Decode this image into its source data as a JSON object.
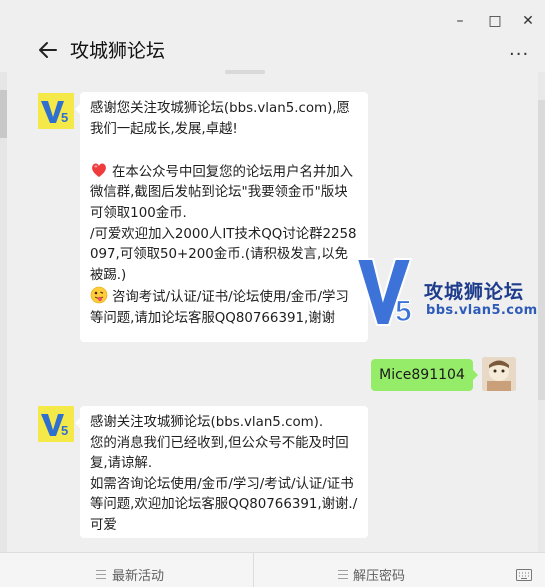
{
  "header": {
    "title": "攻城狮论坛"
  },
  "messages": [
    {
      "sender": "official",
      "lines": [
        "感谢您关注攻城狮论坛(bbs.vlan5.com),愿我们一起成长,发展,卓越!",
        "",
        "在本公众号中回复您的论坛用户名并加入微信群,截图后发帖到论坛\"我要领金币\"版块可领取100金币.",
        "/可爱欢迎加入2000人IT技术QQ讨论群2258097,可领取50+200金币.(请积极发言,以免被踢.)",
        "咨询考试/认证/证书/论坛使用/金币/学习等问题,请加论坛客服QQ80766391,谢谢"
      ],
      "emoji_1": "heart-icon",
      "emoji_2": "tongue-face-icon"
    },
    {
      "sender": "user",
      "text": "Mice891104"
    },
    {
      "sender": "official",
      "lines": [
        "感谢关注攻城狮论坛(bbs.vlan5.com).",
        "您的消息我们已经收到,但公众号不能及时回复,请谅解.",
        "如需咨询论坛使用/金币/学习/考试/认证/证书等问题,欢迎加论坛客服QQ80766391,谢谢./可爱"
      ]
    }
  ],
  "watermark": {
    "title": "攻城狮论坛",
    "url": "bbs.vlan5.com"
  },
  "footer": {
    "menu_1": "最新活动",
    "menu_2": "解压密码"
  },
  "colors": {
    "background": "#efefef",
    "my_bubble": "#95ec69",
    "watermark": "#1e3c8c"
  }
}
